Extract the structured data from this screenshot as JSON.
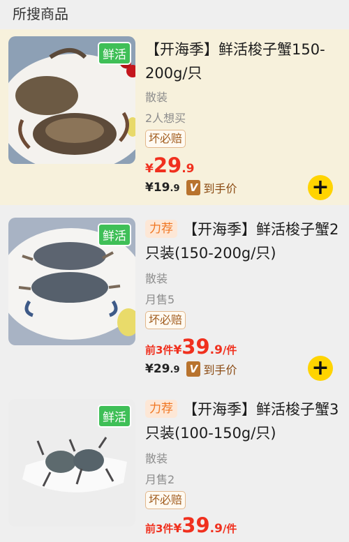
{
  "header": {
    "title": "所搜商品"
  },
  "products": [
    {
      "fresh_badge": "鲜活",
      "recommend_tag": "",
      "title": "【开海季】鲜活梭子蟹150-200g/只",
      "spec": "散装",
      "sales": "2人想买",
      "guarantee": "坏必赔",
      "promo_prefix": "",
      "price_symbol": "¥",
      "price_int": "29",
      "price_dec": ".9",
      "price_suffix": "",
      "vip_price_int": "¥19",
      "vip_price_dec": ".9",
      "vip_badge": "V",
      "vip_label": "到手价",
      "add_button": "+"
    },
    {
      "fresh_badge": "鲜活",
      "recommend_tag": "力荐",
      "title": "【开海季】鲜活梭子蟹2只装(150-200g/只)",
      "spec": "散装",
      "sales": "月售5",
      "guarantee": "坏必赔",
      "promo_prefix": "前3件",
      "price_symbol": "¥",
      "price_int": "39",
      "price_dec": ".9",
      "price_suffix": "/件",
      "vip_price_int": "¥29",
      "vip_price_dec": ".9",
      "vip_badge": "V",
      "vip_label": "到手价",
      "add_button": "+"
    },
    {
      "fresh_badge": "鲜活",
      "recommend_tag": "力荐",
      "title": "【开海季】鲜活梭子蟹3只装(100-150g/只)",
      "spec": "散装",
      "sales": "月售2",
      "guarantee": "坏必赔",
      "promo_prefix": "前3件",
      "price_symbol": "¥",
      "price_int": "39",
      "price_dec": ".9",
      "price_suffix": "/件"
    }
  ]
}
